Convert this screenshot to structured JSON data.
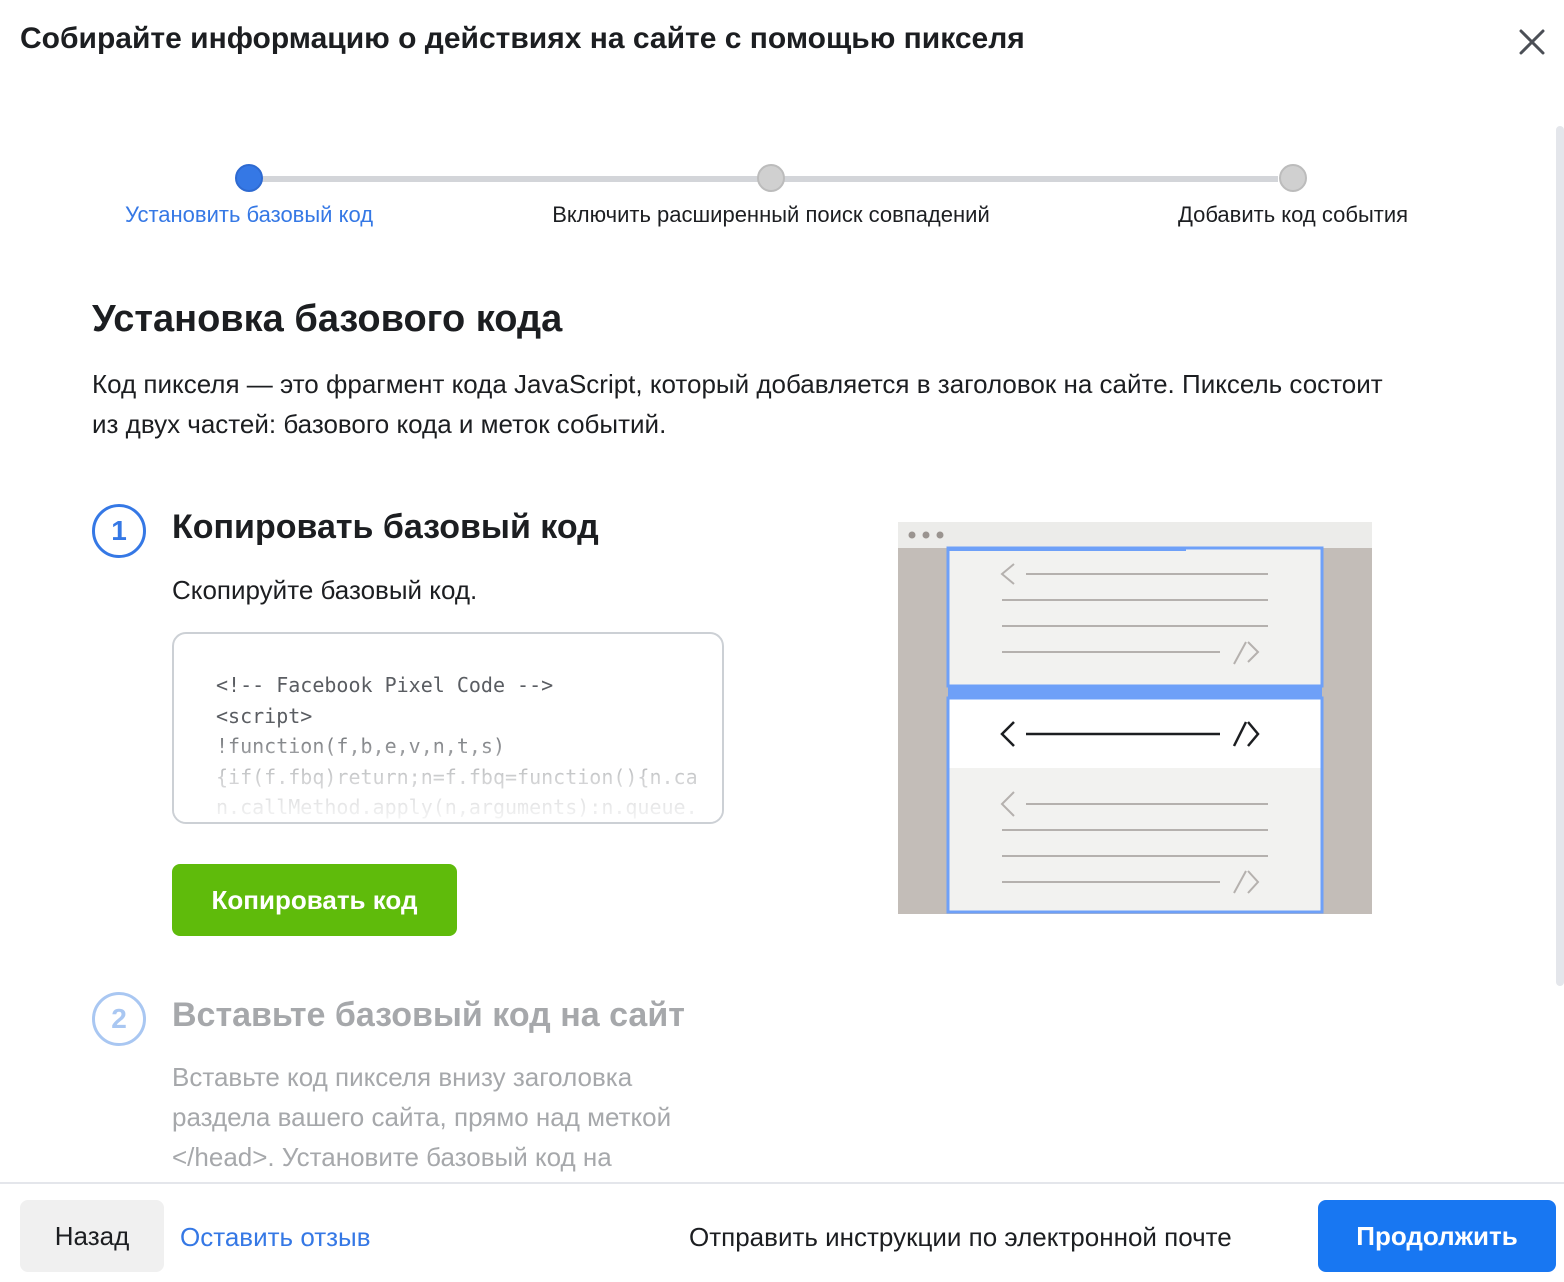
{
  "dialog": {
    "title": "Собирайте информацию о действиях на сайте с помощью пикселя",
    "close_icon": "close-icon"
  },
  "stepper": {
    "steps": [
      {
        "label": "Установить базовый код",
        "state": "active"
      },
      {
        "label": "Включить расширенный поиск совпадений",
        "state": "inactive"
      },
      {
        "label": "Добавить код события",
        "state": "inactive"
      }
    ]
  },
  "section": {
    "title": "Установка базового кода",
    "description": "Код пикселя — это фрагмент кода JavaScript, который добавляется в заголовок на сайте. Пиксель состоит из двух частей: базового кода и меток событий."
  },
  "step1": {
    "number": "1",
    "title": "Копировать базовый код",
    "description": "Скопируйте базовый код.",
    "code_lines": [
      "<!-- Facebook Pixel Code -->",
      "<script>",
      "!function(f,b,e,v,n,t,s)",
      "{if(f.fbq)return;n=f.fbq=function(){n.ca",
      "n.callMethod.apply(n,arguments):n.queue."
    ],
    "copy_button": "Копировать код"
  },
  "step2": {
    "number": "2",
    "title": "Вставьте базовый код на сайт",
    "description_lines": [
      "Вставьте код пикселя внизу заголовка",
      "раздела вашего сайта, прямо над меткой",
      "</head>. Установите базовый код на"
    ]
  },
  "footer": {
    "back": "Назад",
    "feedback": "Оставить отзыв",
    "email": "Отправить инструкции по электронной почте",
    "continue": "Продолжить"
  },
  "colors": {
    "accent": "#3578e5",
    "primary_button": "#1877f2",
    "copy_button": "#5fbb0b",
    "illustration_highlight": "#6ea0f8"
  }
}
